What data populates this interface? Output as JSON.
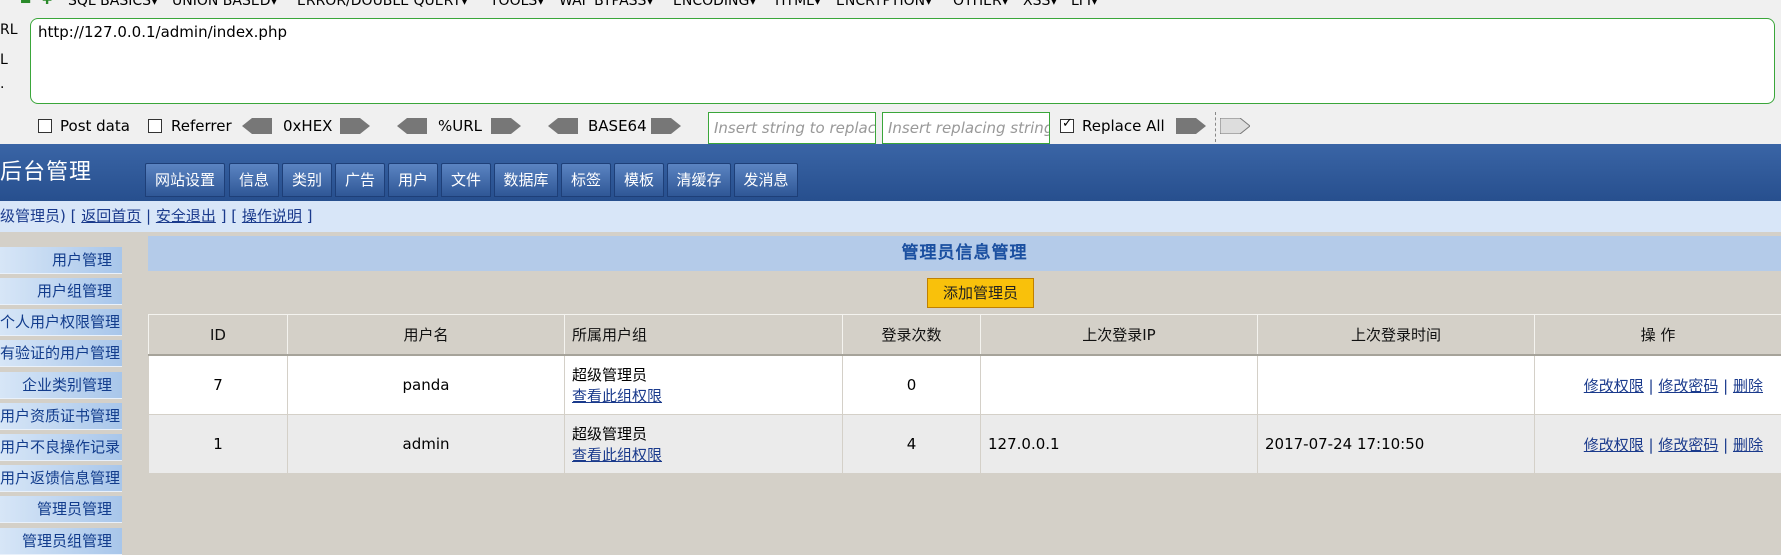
{
  "hackbar": {
    "menu": [
      "SQL BASICS▾",
      "UNION BASED▾",
      "ERROR/DOUBLE QUERY▾",
      "TOOLS▾",
      "WAF BYPASS▾",
      "ENCODING▾",
      "HTML▾",
      "ENCRYPTION▾",
      "OTHER▾",
      "XSS▾",
      "LFI▾"
    ],
    "side_labels": [
      "RL",
      "L",
      "."
    ],
    "url": "http://127.0.0.1/admin/index.php",
    "post_data_label": "Post data",
    "referrer_label": "Referrer",
    "hex_label": "0xHEX",
    "url_label": "%URL",
    "base64_label": "BASE64",
    "replace_placeholder": "Insert string to replace",
    "replacing_placeholder": "Insert replacing string",
    "replace_all_label": "Replace All"
  },
  "header": {
    "title": "后台管理",
    "tabs": [
      "网站设置",
      "信息",
      "类别",
      "广告",
      "用户",
      "文件",
      "数据库",
      "标签",
      "模板",
      "清缓存",
      "发消息"
    ]
  },
  "info_bar": {
    "prefix": "级管理员) [ ",
    "home": "返回首页",
    "sep1": " | ",
    "logout": "安全退出",
    "sep2": " ] [ ",
    "help": "操作说明",
    "suffix": " ]"
  },
  "sidebar": {
    "items": [
      "用户管理",
      "用户组管理",
      "个人用户权限管理",
      "有验证的用户管理",
      "企业类别管理",
      "用户资质证书管理",
      "用户不良操作记录",
      "用户返馈信息管理",
      "管理员管理",
      "管理员组管理"
    ]
  },
  "main": {
    "title": "管理员信息管理",
    "add_button": "添加管理员",
    "columns": [
      "ID",
      "用户名",
      "所属用户组",
      "登录次数",
      "上次登录IP",
      "上次登录时间",
      "操 作"
    ],
    "rows": [
      {
        "id": "7",
        "username": "panda",
        "group": "超级管理员",
        "group_link": "查看此组权限",
        "logins": "0",
        "ip": "",
        "time": "",
        "a1": "修改权限",
        "a2": "修改密码",
        "a3": "删除"
      },
      {
        "id": "1",
        "username": "admin",
        "group": "超级管理员",
        "group_link": "查看此组权限",
        "logins": "4",
        "ip": "127.0.0.1",
        "time": "2017-07-24 17:10:50",
        "a1": "修改权限",
        "a2": "修改密码",
        "a3": "删除"
      }
    ],
    "action_sep": " | "
  }
}
